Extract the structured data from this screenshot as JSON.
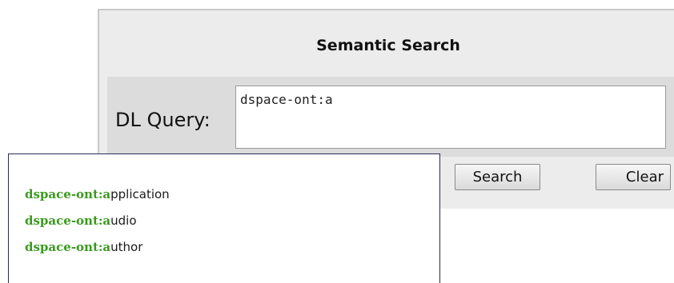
{
  "panel": {
    "title": "Semantic Search",
    "query_label": "DL Query:",
    "query_value": "dspace-ont:a",
    "search_button": "Search",
    "clear_button": "Clear"
  },
  "autocomplete": {
    "matched_prefix": "dspace-ont:a",
    "items": [
      {
        "prefix": "dspace-ont:a",
        "rest": "pplication"
      },
      {
        "prefix": "dspace-ont:a",
        "rest": "udio"
      },
      {
        "prefix": "dspace-ont:a",
        "rest": "uthor"
      }
    ]
  },
  "colors": {
    "panel_bg": "#ececec",
    "query_row_bg": "#dcdcdc",
    "match_green": "#3a9a1e",
    "dropdown_border": "#2a2a55"
  }
}
